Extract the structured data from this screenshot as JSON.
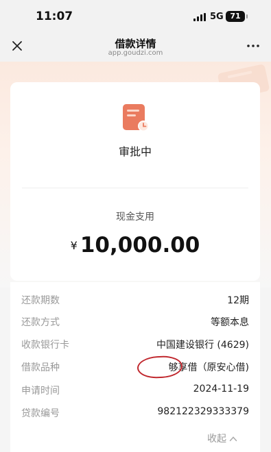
{
  "status_bar": {
    "time": "11:07",
    "network": "5G",
    "battery": "71"
  },
  "nav": {
    "title": "借款详情",
    "subtitle": "app.goudzi.com"
  },
  "status": {
    "label": "审批中"
  },
  "loan": {
    "purpose": "现金支用",
    "currency": "¥",
    "amount": "10,000.00"
  },
  "details": {
    "rows": [
      {
        "label": "还款期数",
        "value": "12期"
      },
      {
        "label": "还款方式",
        "value": "等额本息"
      },
      {
        "label": "收款银行卡",
        "value": "中国建设银行 (4629)"
      },
      {
        "label": "借款品种",
        "value": "够享借（原安心借)"
      },
      {
        "label": "申请时间",
        "value": "2024-11-19"
      },
      {
        "label": "贷款编号",
        "value": "982122329333379"
      }
    ],
    "collapse_label": "收起"
  },
  "colors": {
    "accent": "#e8735a",
    "annotation": "#c0272d"
  }
}
